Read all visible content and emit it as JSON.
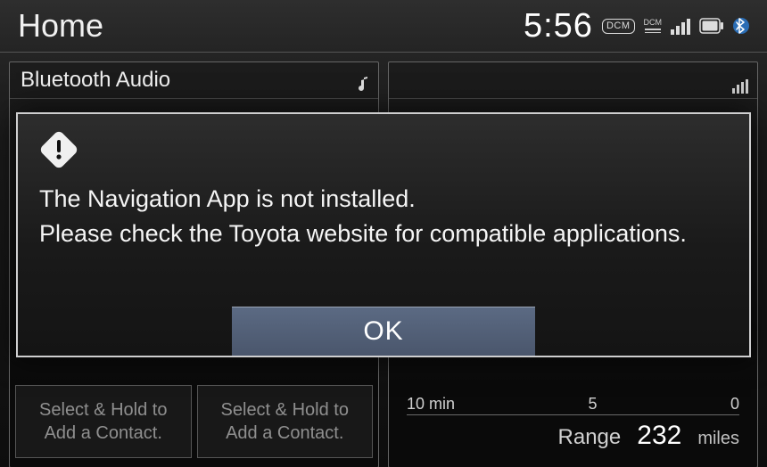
{
  "status": {
    "home_label": "Home",
    "clock": "5:56",
    "dcm_badge": "DCM",
    "dcm_small": "DCM"
  },
  "left_panel": {
    "title": "Bluetooth Audio",
    "contact_line1": "Select & Hold to",
    "contact_line2": "Add a Contact."
  },
  "right_panel": {
    "ticks": {
      "a": "10 min",
      "b": "5",
      "c": "0"
    },
    "range_label": "Range",
    "range_value": "232",
    "range_unit": "miles"
  },
  "modal": {
    "line1": "The Navigation App is not installed.",
    "line2": "Please check the Toyota website for compatible applications.",
    "ok": "OK"
  }
}
